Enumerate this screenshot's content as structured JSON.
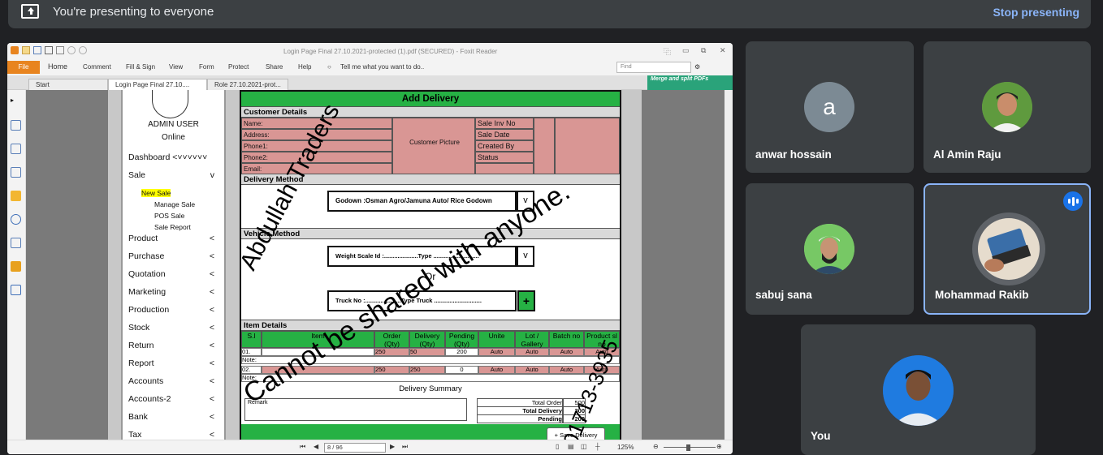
{
  "meet": {
    "presenting_text": "You're presenting to everyone",
    "stop_label": "Stop presenting",
    "participants": [
      {
        "name": "anwar hossain",
        "initial": "a",
        "avatar_color": "#7c8a94"
      },
      {
        "name": "Al Amin Raju"
      },
      {
        "name": "sabuj sana"
      },
      {
        "name": "Mohammad Rakib",
        "speaking": true
      },
      {
        "name": "You"
      }
    ],
    "accent": "#8ab4f8",
    "speaking_border": "#8ab4f8"
  },
  "foxit": {
    "window_title": "Login Page Final 27.10.2021-protected (1).pdf (SECURED) - Foxit Reader",
    "menu": [
      "File",
      "Home",
      "Comment",
      "Fill & Sign",
      "View",
      "Form",
      "Protect",
      "Share",
      "Help"
    ],
    "tell_me": "Tell me what you want to do..",
    "find_placeholder": "Find",
    "tabs": [
      "Start",
      "Login Page Final 27.10....",
      "Role 27.10.2021-prot..."
    ],
    "merge_banner": "Merge and split PDFs",
    "page_indicator": "8 / 96",
    "zoom": "125%"
  },
  "document": {
    "admin_user": "ADMIN USER",
    "online": "Online",
    "dashboard": "Dashboard <˅˅˅˅˅˅",
    "nav": [
      {
        "label": "Sale",
        "chev": "v"
      },
      {
        "label": "Product",
        "chev": "<"
      },
      {
        "label": "Purchase",
        "chev": "<"
      },
      {
        "label": "Quotation",
        "chev": "<"
      },
      {
        "label": "Marketing",
        "chev": "<"
      },
      {
        "label": "Production",
        "chev": "<"
      },
      {
        "label": "Stock",
        "chev": "<"
      },
      {
        "label": "Return",
        "chev": "<"
      },
      {
        "label": "Report",
        "chev": "<"
      },
      {
        "label": "Accounts",
        "chev": "<"
      },
      {
        "label": "Accounts-2",
        "chev": "<"
      },
      {
        "label": "Bank",
        "chev": "<"
      },
      {
        "label": "Tax",
        "chev": "<"
      }
    ],
    "sale_sub": [
      "New Sale",
      "Manage Sale",
      "POS Sale",
      "Sale Report"
    ],
    "form_title": "Add Delivery",
    "customer_details": "Customer Details",
    "customer_fields": [
      "Name:",
      "Address:",
      "Phone1:",
      "Phone2:",
      "Email:"
    ],
    "customer_picture": "Customer Picture",
    "sale_fields": [
      "Sale Inv No",
      "Sale Date",
      "Created By",
      "Status"
    ],
    "delivery_method": "Delivery Method",
    "godown": "Godown :Osman Agro/Jamuna Auto/ Rice Godown",
    "vehicle_method": "Vehicle Method",
    "weight_scale": "Weight Scale Id :....................Type ...........................",
    "or": "Or",
    "truck": "Truck No :.....................Type Truck ............................",
    "chev": "v",
    "plus": "+",
    "item_details": "Item Details",
    "item_headers": [
      "S.l",
      "Item",
      "Order (Qty)",
      "Delivery (Qty)",
      "Pending (Qty)",
      "Unite",
      "Lot / Gallery",
      "Batch no",
      "Product sl no"
    ],
    "rows": [
      {
        "sl": "01.",
        "order": "250",
        "delivery": "50",
        "pending": "200",
        "unite": "Auto",
        "lot": "Auto",
        "batch": "Auto",
        "product": "Auto"
      },
      {
        "sl": "02.",
        "order": "250",
        "delivery": "250",
        "pending": "0",
        "unite": "Auto",
        "lot": "Auto",
        "batch": "Auto",
        "product": "Auto"
      }
    ],
    "note": "Note:",
    "delivery_summary": "Delivery Summary",
    "remark": "Remark",
    "total_order": "Total Order",
    "total_order_val": "500",
    "total_delivery": "Total Delivery",
    "total_delivery_val": "300",
    "pending": "Pending",
    "pending_val": "200",
    "save_delivery": "+ Save Delivery",
    "watermark_lines": [
      "Abdullah Traders",
      "Cannot be shared with anyone.",
      "01713-3935"
    ]
  }
}
